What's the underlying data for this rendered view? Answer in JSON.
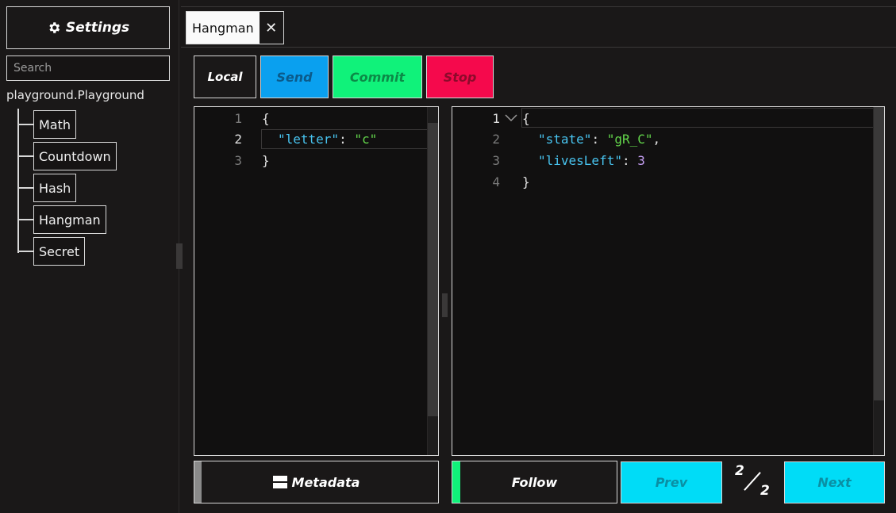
{
  "sidebar": {
    "settings_label": "Settings",
    "search_placeholder": "Search",
    "root": "playground.Playground",
    "items": [
      {
        "label": "Math"
      },
      {
        "label": "Countdown"
      },
      {
        "label": "Hash"
      },
      {
        "label": "Hangman"
      },
      {
        "label": "Secret"
      }
    ]
  },
  "tab": {
    "label": "Hangman",
    "close": "✕"
  },
  "toolbar": {
    "local": "Local",
    "send": "Send",
    "commit": "Commit",
    "stop": "Stop"
  },
  "input_editor": {
    "line_numbers": [
      "1",
      "2",
      "3"
    ],
    "lines": {
      "l1": "{",
      "key": "\"letter\"",
      "colon": ": ",
      "value": "\"c\"",
      "l3": "}"
    }
  },
  "output_editor": {
    "line_numbers": [
      "1",
      "2",
      "3",
      "4"
    ],
    "lines": {
      "l1": "{",
      "key1": "\"state\"",
      "colon1": ": ",
      "value1": "\"gR_C\"",
      "comma1": ",",
      "key2": "\"livesLeft\"",
      "colon2": ": ",
      "value2": "3",
      "l4": "}"
    }
  },
  "footer": {
    "metadata": "Metadata",
    "follow": "Follow",
    "prev": "Prev",
    "next": "Next",
    "page_current": "2",
    "page_total": "2"
  },
  "colors": {
    "send": "#0aa0ef",
    "commit": "#10f27a",
    "stop": "#f5094c",
    "nav": "#00dcf7"
  }
}
